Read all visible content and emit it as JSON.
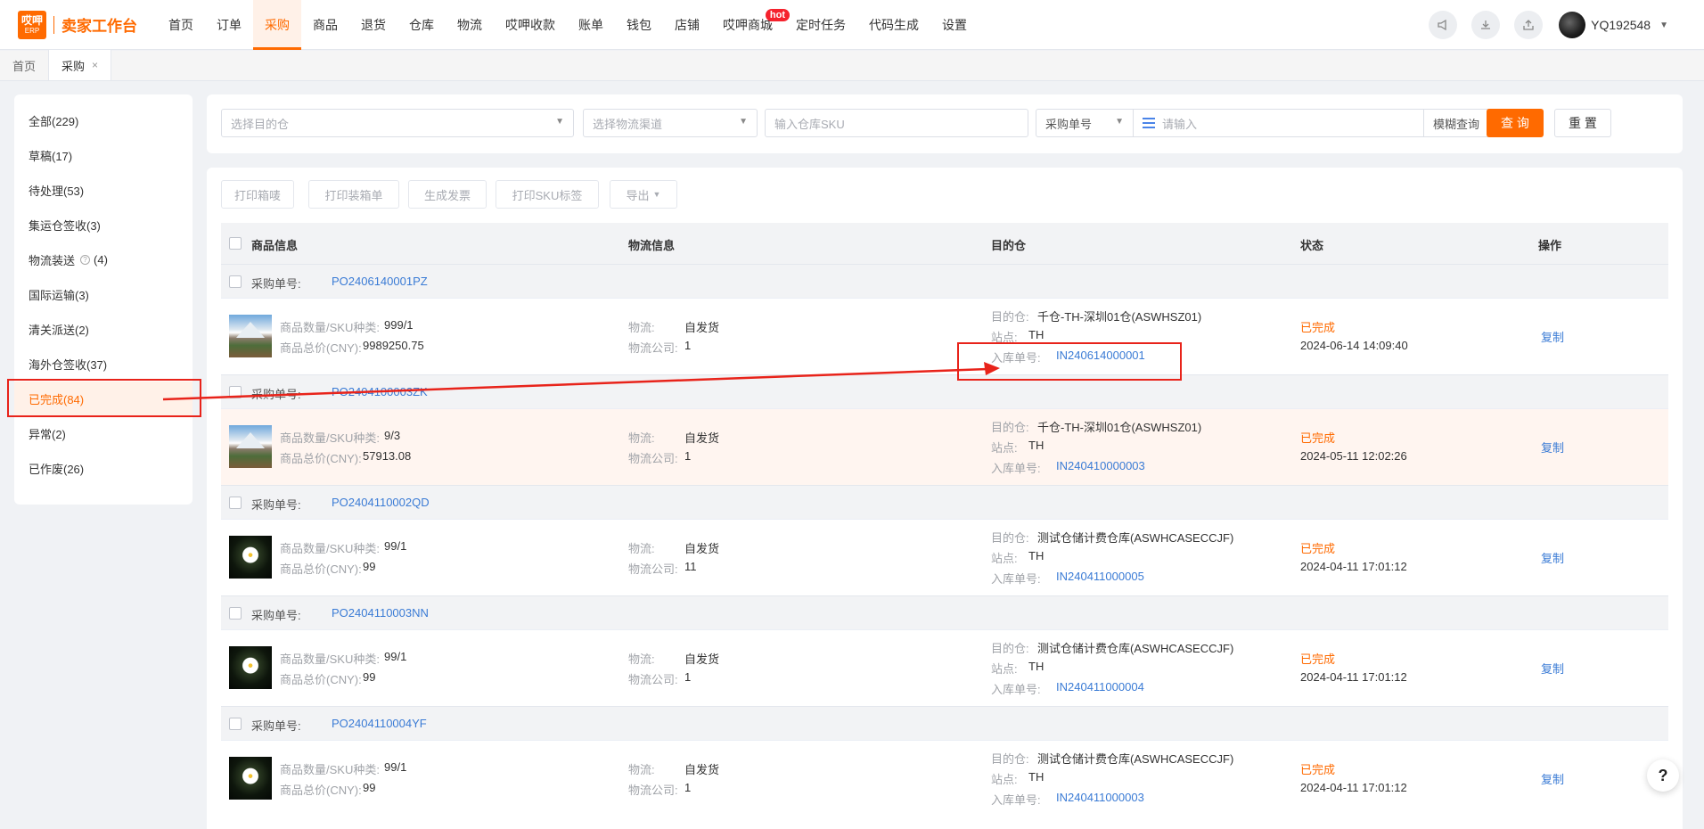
{
  "app": {
    "logo_top": "哎呷",
    "logo_bottom": "ERP",
    "title": "卖家工作台"
  },
  "nav": [
    {
      "label": "首页"
    },
    {
      "label": "订单"
    },
    {
      "label": "采购"
    },
    {
      "label": "商品"
    },
    {
      "label": "退货"
    },
    {
      "label": "仓库"
    },
    {
      "label": "物流"
    },
    {
      "label": "哎呷收款"
    },
    {
      "label": "账单"
    },
    {
      "label": "钱包"
    },
    {
      "label": "店铺"
    },
    {
      "label": "哎呷商城",
      "badge": "hot"
    },
    {
      "label": "定时任务"
    },
    {
      "label": "代码生成"
    },
    {
      "label": "设置"
    }
  ],
  "user": {
    "name": "YQ192548"
  },
  "tabs": [
    {
      "label": "首页"
    },
    {
      "label": "采购",
      "close": "×"
    }
  ],
  "statuses": [
    {
      "label": "全部(229)"
    },
    {
      "label": "草稿(17)"
    },
    {
      "label": "待处理(53)"
    },
    {
      "label": "集运仓签收(3)"
    },
    {
      "label": "物流装送",
      "count": "(4)"
    },
    {
      "label": "国际运输(3)"
    },
    {
      "label": "清关派送(2)"
    },
    {
      "label": "海外仓签收(37)"
    },
    {
      "label": "已完成(84)"
    },
    {
      "label": "异常(2)"
    },
    {
      "label": "已作废(26)"
    }
  ],
  "filters": {
    "warehouse_placeholder": "选择目的仓",
    "channel_placeholder": "选择物流渠道",
    "sku_placeholder": "输入仓库SKU",
    "order_type": "采购单号",
    "input_placeholder": "请输入",
    "match_mode": "模糊查询",
    "search": "查 询",
    "reset": "重 置"
  },
  "actions": {
    "print_label": "打印箱唛",
    "print_packing": "打印装箱单",
    "invoice": "生成发票",
    "print_sku": "打印SKU标签",
    "export": "导出"
  },
  "columns": {
    "product": "商品信息",
    "logistics": "物流信息",
    "warehouse": "目的仓",
    "status": "状态",
    "ops": "操作"
  },
  "labels": {
    "po": "采购单号:",
    "qty": "商品数量/SKU种类:",
    "total": "商品总价(CNY):",
    "logistics": "物流:",
    "company": "物流公司:",
    "warehouse": "目的仓:",
    "site": "站点:",
    "inbound": "入库单号:",
    "copy": "复制"
  },
  "orders": [
    {
      "po": "PO2406140001PZ",
      "qty": "999/1",
      "total": "9989250.75",
      "logistics": "自发货",
      "company": "1",
      "warehouse": "千仓-TH-深圳01仓(ASWHSZ01)",
      "site": "TH",
      "inbound": "IN240614000001",
      "status": "已完成",
      "date": "2024-06-14 14:09:40"
    },
    {
      "po": "PO2404100003ZK",
      "qty": "9/3",
      "total": "57913.08",
      "logistics": "自发货",
      "company": "1",
      "warehouse": "千仓-TH-深圳01仓(ASWHSZ01)",
      "site": "TH",
      "inbound": "IN240410000003",
      "status": "已完成",
      "date": "2024-05-11 12:02:26"
    },
    {
      "po": "PO2404110002QD",
      "qty": "99/1",
      "total": "99",
      "logistics": "自发货",
      "company": "11",
      "warehouse": "测试仓储计费仓库(ASWHCASECCJF)",
      "site": "TH",
      "inbound": "IN240411000005",
      "status": "已完成",
      "date": "2024-04-11 17:01:12"
    },
    {
      "po": "PO2404110003NN",
      "qty": "99/1",
      "total": "99",
      "logistics": "自发货",
      "company": "1",
      "warehouse": "测试仓储计费仓库(ASWHCASECCJF)",
      "site": "TH",
      "inbound": "IN240411000004",
      "status": "已完成",
      "date": "2024-04-11 17:01:12"
    },
    {
      "po": "PO2404110004YF",
      "qty": "99/1",
      "total": "99",
      "logistics": "自发货",
      "company": "1",
      "warehouse": "测试仓储计费仓库(ASWHCASECCJF)",
      "site": "TH",
      "inbound": "IN240411000003",
      "status": "已完成",
      "date": "2024-04-11 17:01:12"
    }
  ],
  "help": "?"
}
